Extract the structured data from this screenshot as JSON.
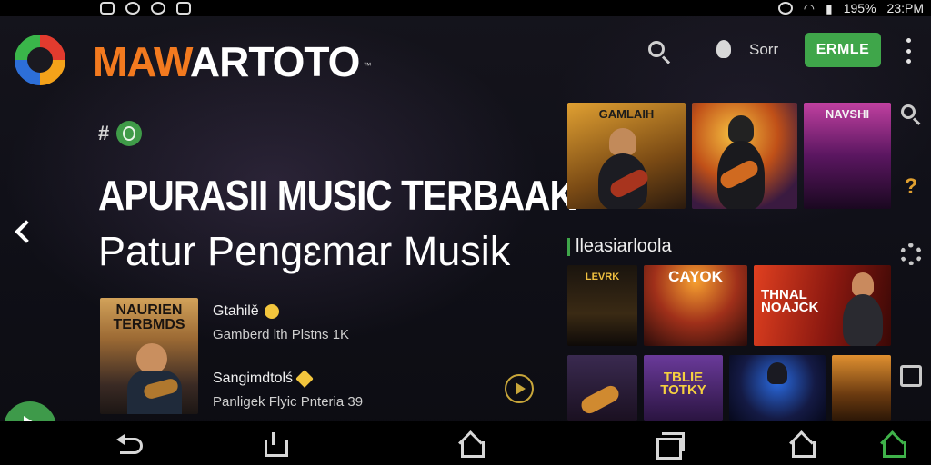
{
  "status_bar": {
    "battery": "195%",
    "time": "23:PM",
    "left_icons": [
      "gallery-icon",
      "whatsapp-icon",
      "clock-icon",
      "home-app-icon"
    ],
    "right_icons": [
      "sync-icon",
      "wifi-icon",
      "signal-icon"
    ]
  },
  "header": {
    "brand_accent": "MAW",
    "brand_rest": "ARTOTO",
    "trademark": "™",
    "sort_label": "Sorr",
    "enable_label": "ERMLE",
    "accent_color": "#3fa64a",
    "brand_color": "#f37a1f"
  },
  "hero": {
    "tag_hash": "#",
    "title": "APURASII MUSIC TERBAAK",
    "subtitle": "Patur Pengɛmar Musik"
  },
  "featured": {
    "album_title": "NAURIEN TERBMDS",
    "tracks": [
      {
        "name": "Gtahilě",
        "meta": "Gamberd lth Plstns 1K"
      },
      {
        "name": "Sangimdtolś",
        "meta": "Panligek Flyic Pnteria 39"
      }
    ]
  },
  "section": {
    "title": "lleasiarloola"
  },
  "grid_top": [
    {
      "label": "GAMLAIH",
      "bg": "#7a5a1a"
    },
    {
      "label": "",
      "bg": "#6a3a20"
    },
    {
      "label": "NAVSHI",
      "bg": "#6a1e5e"
    }
  ],
  "grid_mid": [
    {
      "label": "LEVRK",
      "bg": "#2a2018"
    },
    {
      "label": "CAYOK",
      "bg": "#8a2d18"
    },
    {
      "label": "THNAL NOAJCK",
      "bg": "#7a1812"
    }
  ],
  "grid_bottom": [
    {
      "label": "",
      "bg": "#2a1a3a"
    },
    {
      "label": "TBLIE TOTKY",
      "bg": "#4a2a5a"
    },
    {
      "label": "",
      "bg": "#141a44"
    },
    {
      "label": "",
      "bg": "#6a3a10"
    }
  ]
}
